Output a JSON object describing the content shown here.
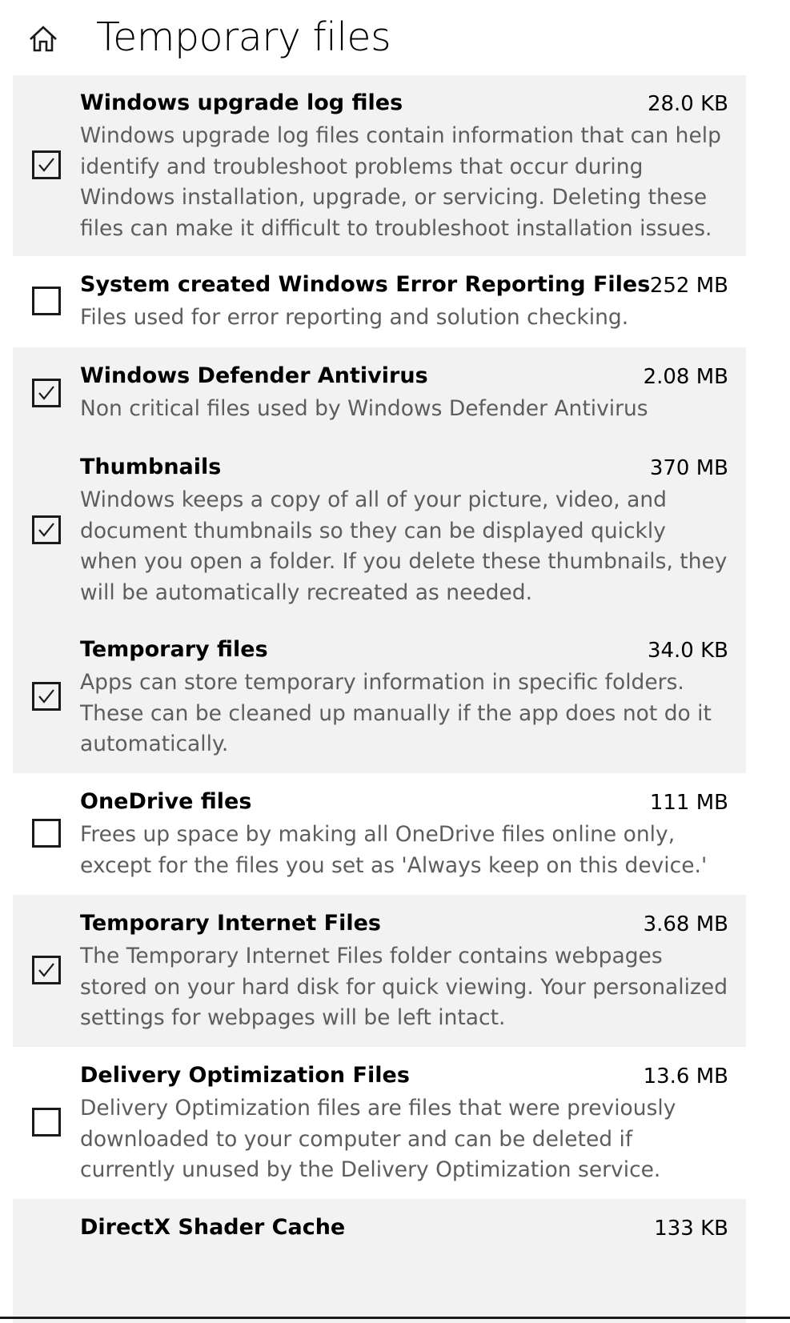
{
  "header": {
    "title": "Temporary files",
    "home_icon": "home-icon"
  },
  "items": [
    {
      "name": "Windows upgrade log files",
      "size": "28.0 KB",
      "checked": true,
      "description": "Windows upgrade log files contain information that can help identify and troubleshoot problems that occur during Windows installation, upgrade, or servicing.  Deleting these files can make it difficult to troubleshoot installation issues."
    },
    {
      "name": "System created Windows Error Reporting Files",
      "size": "252 MB",
      "checked": false,
      "description": "Files used for error reporting and solution checking."
    },
    {
      "name": "Windows Defender Antivirus",
      "size": "2.08 MB",
      "checked": true,
      "description": "Non critical files used by Windows Defender Antivirus"
    },
    {
      "name": "Thumbnails",
      "size": "370 MB",
      "checked": true,
      "description": "Windows keeps a copy of all of your picture, video, and document thumbnails so they can be displayed quickly when you open a folder. If you delete these thumbnails, they will be automatically recreated as needed."
    },
    {
      "name": "Temporary files",
      "size": "34.0 KB",
      "checked": true,
      "description": "Apps can store temporary information in specific folders. These can be cleaned up manually if the app does not do it automatically."
    },
    {
      "name": "OneDrive files",
      "size": "111 MB",
      "checked": false,
      "description": "Frees up space by making all OneDrive files online only, except for the files you set as 'Always keep on this device.'"
    },
    {
      "name": "Temporary Internet Files",
      "size": "3.68 MB",
      "checked": true,
      "description": "The Temporary Internet Files folder contains webpages stored on your hard disk for quick viewing. Your personalized settings for webpages will be left intact."
    },
    {
      "name": "Delivery Optimization Files",
      "size": "13.6 MB",
      "checked": false,
      "description": "Delivery Optimization files are files that were previously downloaded to your computer and can be deleted if currently unused by the Delivery Optimization service."
    },
    {
      "name": "DirectX Shader Cache",
      "size": "133 KB",
      "checked": true,
      "description": ""
    }
  ],
  "colors": {
    "selected_background": "#f2f2f2",
    "description_text": "#5d5d5d",
    "checkbox_border": "#1a1a1a"
  }
}
